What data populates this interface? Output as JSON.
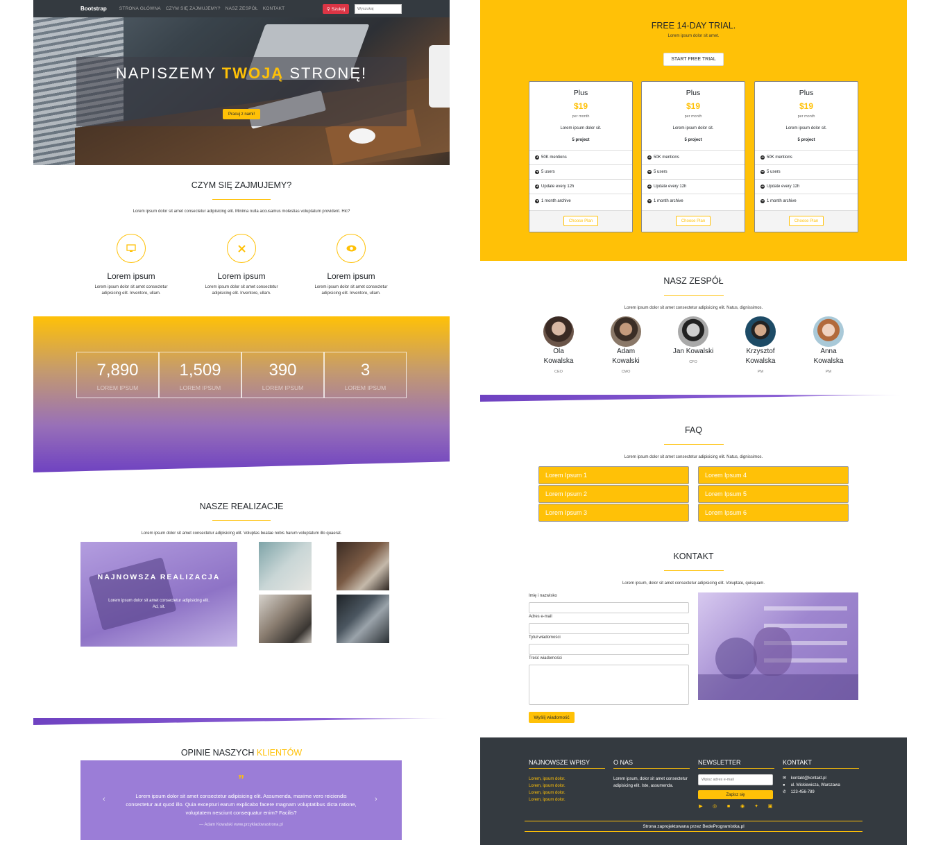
{
  "nav": {
    "brand": "Bootstrap",
    "links": [
      "STRONA GŁÓWNA",
      "CZYM SIĘ ZAJMUJEMY?",
      "NASZ ZESPÓŁ",
      "KONTAKT"
    ],
    "search_button": "Szukaj",
    "search_placeholder": "Wyszukaj"
  },
  "hero": {
    "title_a": "NAPISZEMY ",
    "title_b": "TWOJĄ",
    "title_c": " STRONĘ!",
    "cta": "Pracuj z nami!"
  },
  "about": {
    "title": "CZYM SIĘ ZAJMUJEMY?",
    "lead": "Lorem ipsum dolor sit amet consectetur adipisicing elit. Minima nulla accusamus molestias voluptatum provident. Hic?",
    "features": [
      {
        "icon": "monitor-icon",
        "title": "Lorem ipsum",
        "text": "Lorem ipsum dolor sit amet consectetur adipisicing elit. Inventore, ullam."
      },
      {
        "icon": "tools-icon",
        "title": "Lorem ipsum",
        "text": "Lorem ipsum dolor sit amet consectetur adipisicing elit. Inventore, ullam."
      },
      {
        "icon": "eye-icon",
        "title": "Lorem ipsum",
        "text": "Lorem ipsum dolor sit amet consectetur adipisicing elit. Inventore, ullam."
      }
    ]
  },
  "stats": [
    {
      "value": "7,890",
      "label": "LOREM IPSUM"
    },
    {
      "value": "1,509",
      "label": "LOREM IPSUM"
    },
    {
      "value": "390",
      "label": "LOREM IPSUM"
    },
    {
      "value": "3",
      "label": "LOREM IPSUM"
    }
  ],
  "portfolio": {
    "title": "NASZE REALIZACJE",
    "lead": "Lorem ipsum dolor sit amet consectetur adipisicing elit. Voluptas beatae nobis harum voluptatum illo quaerat.",
    "featured_title": "NAJNOWSZA REALIZACJA",
    "featured_text": "Lorem ipsum dolor sit amet consectetur adipisicing elit. Ad, sit."
  },
  "testimonials": {
    "title_a": "OPINIE NASZYCH ",
    "title_b": "KLIENTÓW",
    "quote_mark": "”",
    "text": "Lorem ipsum dolor sit amet consectetur adipisicing elit. Assumenda, maxime vero reiciendis consectetur aut quod illo. Quia excepturi earum explicabo facere magnam voluptatibus dicta ratione, voluptatem nesciunt consequatur enim? Facilis?",
    "author": "— Adam Kowalski www.przykladowastrona.pl",
    "prev": "‹",
    "next": "›"
  },
  "pricing": {
    "title": "FREE 14-DAY TRIAL.",
    "lead": "Lorem ipsum dolor sit amet.",
    "button": "START FREE TRIAL",
    "plans": [
      {
        "name": "Plus",
        "price": "$19",
        "period": "per month",
        "desc": "Lorem ipsum dolor sit.",
        "projects": "5 project",
        "features": [
          "50K mentions",
          "5 users",
          "Update every 12h",
          "1 month archive"
        ],
        "cta": "Choose Plan"
      },
      {
        "name": "Plus",
        "price": "$19",
        "period": "per month",
        "desc": "Lorem ipsum dolor sit.",
        "projects": "5 project",
        "features": [
          "50K mentions",
          "5 users",
          "Update every 12h",
          "1 month archive"
        ],
        "cta": "Choose Plan"
      },
      {
        "name": "Plus",
        "price": "$19",
        "period": "per month",
        "desc": "Lorem ipsum dolor sit.",
        "projects": "5 project",
        "features": [
          "50K mentions",
          "5 users",
          "Update every 12h",
          "1 month archive"
        ],
        "cta": "Choose Plan"
      }
    ]
  },
  "team": {
    "title": "NASZ ZESPÓŁ",
    "lead": "Lorem ipsum dolor sit amet consectetur adipisicing elit. Natus, dignissimos.",
    "members": [
      {
        "first": "Ola",
        "last": "Kowalska",
        "role": "CEO"
      },
      {
        "first": "Adam",
        "last": "Kowalski",
        "role": "CMO"
      },
      {
        "first": "Jan Kowalski",
        "last": "",
        "role": "CFO"
      },
      {
        "first": "Krzysztof",
        "last": "Kowalska",
        "role": "PM"
      },
      {
        "first": "Anna",
        "last": "Kowalska",
        "role": "PM"
      }
    ]
  },
  "faq": {
    "title": "FAQ",
    "lead": "Lorem ipsum dolor sit amet consectetur adipisicing elit. Natus, dignissimos.",
    "items": [
      "Lorem Ipsum 1",
      "Lorem Ipsum 2",
      "Lorem Ipsum 3",
      "Lorem Ipsum 4",
      "Lorem Ipsum 5",
      "Lorem Ipsum 6"
    ]
  },
  "contact": {
    "title": "KONTAKT",
    "lead": "Lorem ipsum, dolor sit amet consectetur adipisicing elit. Voluptate, quisquam.",
    "labels": [
      "Imię i nazwisko",
      "Adres e-mail",
      "Tytuł wiadomości",
      "Treść wiadomości"
    ],
    "submit": "Wyślij wiadomość"
  },
  "footer": {
    "col1_title": "NAJNOWSZE WPISY",
    "col1_links": [
      "Lorem, ipsum dolor.",
      "Lorem, ipsum dolor.",
      "Lorem, ipsum dolor.",
      "Lorem, ipsum dolor."
    ],
    "col2_title": "O NAS",
    "col2_text": "Lorem ipsum, dolor sit amet consectetur adipisicing elit. Iste, assumenda.",
    "col3_title": "NEWSLETTER",
    "newsletter_placeholder": "Wpisz adres e-mail",
    "newsletter_button": "Zapisz się",
    "col4_title": "KONTAKT",
    "email": "kontakt@kontakt.pl",
    "address": "ul. Mickiewicza, Warszawa",
    "phone": "123-456-789",
    "copyright": "Strona zaprojektowana przez BedeProgramistka.pl",
    "social": [
      "youtube-icon",
      "dribbble-icon",
      "facebook-icon",
      "github-icon",
      "twitter-icon",
      "instagram-icon"
    ]
  },
  "colors": {
    "accent": "#ffc107",
    "purple": "#6f42c1",
    "dark": "#343a40",
    "danger": "#dc3545"
  }
}
